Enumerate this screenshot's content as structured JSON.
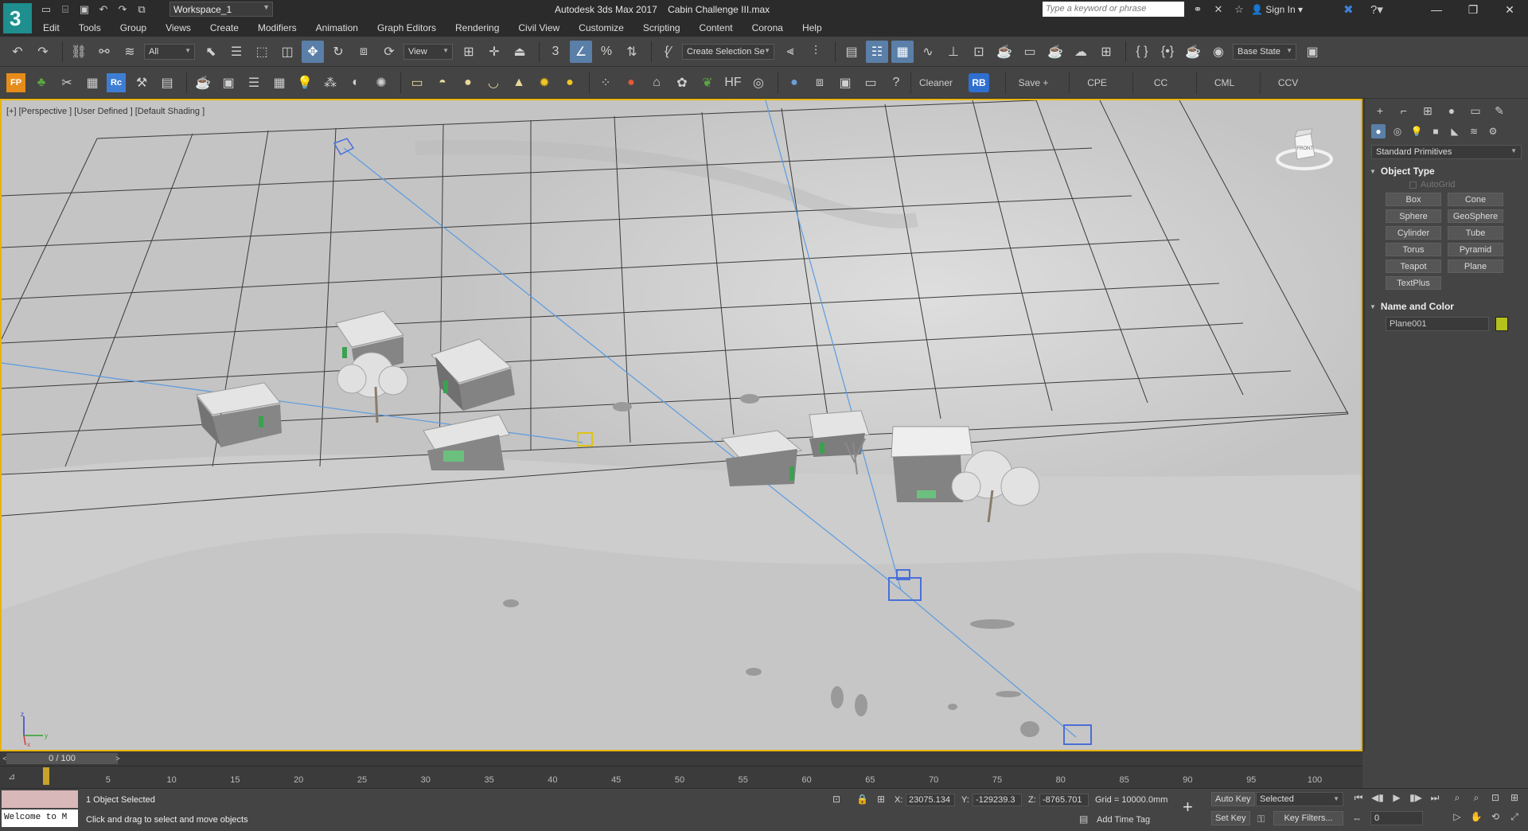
{
  "titlebar": {
    "app_title": "Autodesk 3ds Max 2017",
    "file_name": "Cabin Challenge III.max",
    "workspace": "Workspace_1",
    "search_placeholder": "Type a keyword or phrase",
    "sign_in": "Sign In"
  },
  "menu": [
    "Edit",
    "Tools",
    "Group",
    "Views",
    "Create",
    "Modifiers",
    "Animation",
    "Graph Editors",
    "Rendering",
    "Civil View",
    "Customize",
    "Scripting",
    "Content",
    "Corona",
    "Help"
  ],
  "toolbar1": {
    "filter": "All",
    "ref_coord": "View",
    "selection_set": "Create Selection Se",
    "state": "Base State"
  },
  "toolbar2": {
    "fp_label": "FP",
    "rc_label": "Rc",
    "rb_label": "RB",
    "buttons": [
      "Cleaner",
      "Save +",
      "CPE",
      "CC",
      "CML",
      "CCV"
    ]
  },
  "viewport": {
    "label": "[+] [Perspective ] [User Defined ] [Default Shading ]",
    "viewcube_label": "FRONT"
  },
  "command_panel": {
    "category": "Standard Primitives",
    "object_type_title": "Object Type",
    "autogrid": "AutoGrid",
    "primitives": [
      "Box",
      "Cone",
      "Sphere",
      "GeoSphere",
      "Cylinder",
      "Tube",
      "Torus",
      "Pyramid",
      "Teapot",
      "Plane",
      "TextPlus"
    ],
    "name_color_title": "Name and Color",
    "object_name": "Plane001",
    "object_color": "#b5c21d"
  },
  "timeline": {
    "frame": "0 / 100",
    "ticks": [
      "5",
      "10",
      "15",
      "20",
      "25",
      "30",
      "35",
      "40",
      "45",
      "50",
      "55",
      "60",
      "65",
      "70",
      "75",
      "80",
      "85",
      "90",
      "95",
      "100"
    ]
  },
  "status": {
    "selection": "1 Object Selected",
    "prompt": "Click and drag to select and move objects",
    "maxscript": "Welcome to M",
    "x_label": "X:",
    "x_value": "23075.134",
    "y_label": "Y:",
    "y_value": "-129239.3",
    "z_label": "Z:",
    "z_value": "-8765.701",
    "grid": "Grid = 10000.0mm",
    "add_time_tag": "Add Time Tag",
    "auto_key": "Auto Key",
    "set_key": "Set Key",
    "key_mode": "Selected",
    "key_filters": "Key Filters...",
    "current_frame": "0"
  },
  "colors": {
    "accent": "#5a7fa8",
    "viewport_border": "#e8b400",
    "viewport_bg": "#c9c9c9"
  }
}
